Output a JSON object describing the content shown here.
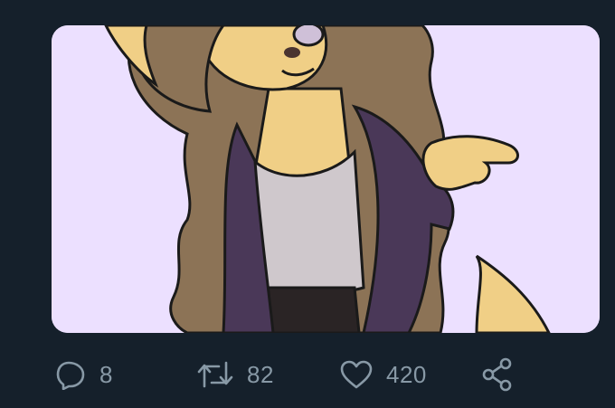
{
  "tweet": {
    "media": {
      "image_alt": ""
    },
    "actions": {
      "reply": {
        "icon": "reply-icon",
        "count": "8"
      },
      "retweet": {
        "icon": "retweet-icon",
        "count": "82"
      },
      "like": {
        "icon": "heart-icon",
        "count": "420"
      },
      "share": {
        "icon": "share-icon"
      }
    }
  },
  "colors": {
    "background": "#15202b",
    "icon_gray": "#8899a6",
    "media_background": "#ece0ff"
  }
}
